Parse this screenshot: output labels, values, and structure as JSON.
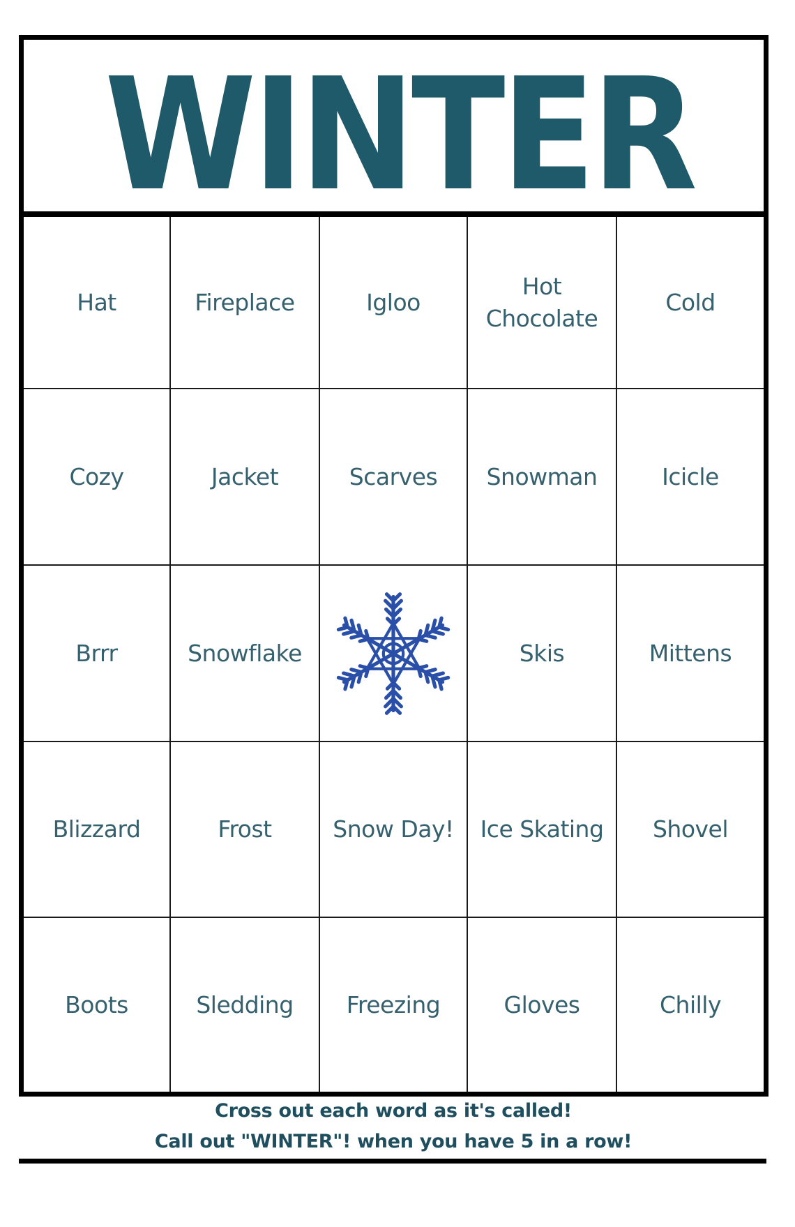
{
  "title": "WINTER",
  "colors": {
    "title": "#1f5a6a",
    "word_text": "#35606e",
    "snowflake": "#2a4fa8",
    "footer_text": "#1f4f5e",
    "grid_lines": "#000000"
  },
  "board": {
    "rows": [
      [
        {
          "text": "Hat"
        },
        {
          "text": "Fireplace"
        },
        {
          "text": "Igloo"
        },
        {
          "text": "Hot Chocolate",
          "lines": [
            "Hot",
            "Chocolate"
          ]
        },
        {
          "text": "Cold"
        }
      ],
      [
        {
          "text": "Cozy"
        },
        {
          "text": "Jacket"
        },
        {
          "text": "Scarves"
        },
        {
          "text": "Snowman"
        },
        {
          "text": "Icicle"
        }
      ],
      [
        {
          "text": "Brrr"
        },
        {
          "text": "Snowflake"
        },
        {
          "text": "",
          "icon": "snowflake-icon",
          "free_space": true
        },
        {
          "text": "Skis"
        },
        {
          "text": "Mittens"
        }
      ],
      [
        {
          "text": "Blizzard"
        },
        {
          "text": "Frost"
        },
        {
          "text": "Snow Day!"
        },
        {
          "text": "Ice Skating"
        },
        {
          "text": "Shovel"
        }
      ],
      [
        {
          "text": "Boots"
        },
        {
          "text": "Sledding"
        },
        {
          "text": "Freezing"
        },
        {
          "text": "Gloves"
        },
        {
          "text": "Chilly"
        }
      ]
    ]
  },
  "footer": {
    "line1": "Cross out each word as it's called!",
    "line2": "Call out \"WINTER\"! when you have 5 in a row!"
  }
}
